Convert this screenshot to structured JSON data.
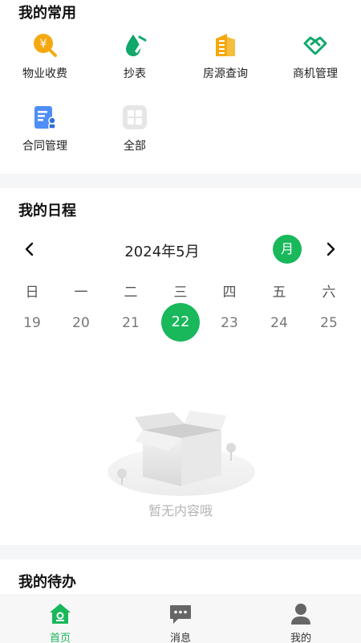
{
  "favorites": {
    "title": "我的常用",
    "items": [
      {
        "label": "物业收费",
        "icon": "yen-coin-icon"
      },
      {
        "label": "抄表",
        "icon": "water-drop-pen-icon"
      },
      {
        "label": "房源查询",
        "icon": "building-icon"
      },
      {
        "label": "商机管理",
        "icon": "handshake-icon"
      },
      {
        "label": "合同管理",
        "icon": "contract-icon"
      },
      {
        "label": "全部",
        "icon": "grid-icon"
      }
    ]
  },
  "schedule": {
    "title": "我的日程",
    "month_title": "2024年5月",
    "view_mode": "月",
    "weekdays": [
      "日",
      "一",
      "二",
      "三",
      "四",
      "五",
      "六"
    ],
    "days": [
      "19",
      "20",
      "21",
      "22",
      "23",
      "24",
      "25"
    ],
    "selected_day": "22",
    "empty_text": "暂无内容哦"
  },
  "todo": {
    "title": "我的待办"
  },
  "tabbar": {
    "items": [
      {
        "label": "首页",
        "icon": "home-icon",
        "active": true
      },
      {
        "label": "消息",
        "icon": "message-icon",
        "active": false
      },
      {
        "label": "我的",
        "icon": "profile-icon",
        "active": false
      }
    ]
  },
  "colors": {
    "accent": "#18b85b",
    "orange": "#f4a911",
    "teal": "#11a86a",
    "blue": "#4f8ef7"
  }
}
